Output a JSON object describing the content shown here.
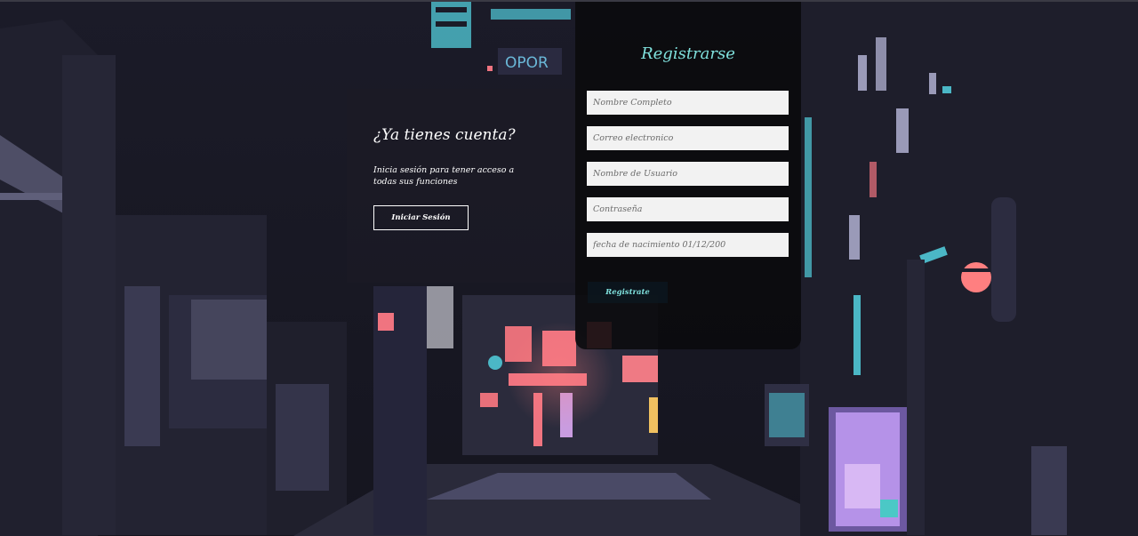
{
  "colors": {
    "accent": "#7fe0dc",
    "field_bg": "#f2f2f2",
    "panel_bg": "#0a0a0c",
    "text": "#ffffff"
  },
  "login": {
    "title": "¿Ya tienes cuenta?",
    "description": "Inicia sesión para tener acceso a todas sus funciones",
    "button_label": "Iniciar Sesión"
  },
  "register": {
    "title": "Registrarse",
    "fields": {
      "full_name": {
        "placeholder": "Nombre Completo",
        "value": ""
      },
      "email": {
        "placeholder": "Correo electronico",
        "value": ""
      },
      "username": {
        "placeholder": "Nombre de Usuario",
        "value": ""
      },
      "password": {
        "placeholder": "Contraseña",
        "value": ""
      },
      "birthdate": {
        "placeholder": "fecha de nacimiento 01/12/200",
        "value": ""
      }
    },
    "button_label": "Registrate"
  },
  "background": {
    "description_icon": "neon-alley-background",
    "signs": [
      "OPOR"
    ]
  }
}
